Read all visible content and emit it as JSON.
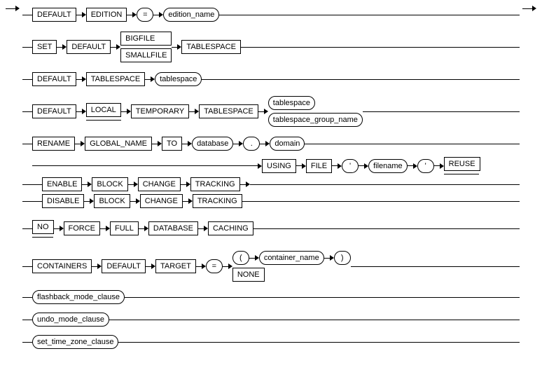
{
  "chart_data": {
    "type": "railroad_diagram",
    "description": "SQL syntax railroad diagram with alternative clauses.",
    "branches": [
      {
        "id": "b1",
        "sequence": [
          "DEFAULT",
          "EDITION",
          {
            "literal": "="
          },
          {
            "nonterminal": "edition_name"
          }
        ]
      },
      {
        "id": "b2",
        "sequence": [
          "SET",
          "DEFAULT",
          {
            "choice": [
              "BIGFILE",
              "SMALLFILE"
            ]
          },
          "TABLESPACE"
        ]
      },
      {
        "id": "b3",
        "sequence": [
          "DEFAULT",
          "TABLESPACE",
          {
            "nonterminal": "tablespace"
          }
        ]
      },
      {
        "id": "b4",
        "sequence": [
          "DEFAULT",
          {
            "optional": "LOCAL"
          },
          "TEMPORARY",
          "TABLESPACE",
          {
            "choice_nt": [
              "tablespace",
              "tablespace_group_name"
            ]
          }
        ]
      },
      {
        "id": "b5",
        "sequence": [
          "RENAME",
          "GLOBAL_NAME",
          "TO",
          {
            "nonterminal": "database"
          },
          {
            "repeat": [
              {
                "literal": "."
              },
              {
                "nonterminal": "domain"
              }
            ]
          }
        ]
      },
      {
        "id": "b6",
        "sequence": [
          "ENABLE",
          "BLOCK",
          "CHANGE",
          "TRACKING",
          {
            "optional_seq": [
              "USING",
              "FILE",
              {
                "literal": "'"
              },
              {
                "nonterminal": "filename"
              },
              {
                "literal": "'"
              },
              {
                "optional": "REUSE"
              }
            ]
          }
        ]
      },
      {
        "id": "b7",
        "sequence": [
          "DISABLE",
          "BLOCK",
          "CHANGE",
          "TRACKING"
        ]
      },
      {
        "id": "b8",
        "sequence": [
          {
            "optional": "NO"
          },
          "FORCE",
          "FULL",
          "DATABASE",
          "CACHING"
        ]
      },
      {
        "id": "b9",
        "sequence": [
          "CONTAINERS",
          "DEFAULT",
          "TARGET",
          {
            "literal": "="
          },
          {
            "choice": [
              {
                "seq": [
                  {
                    "literal": "("
                  },
                  {
                    "nonterminal": "container_name"
                  },
                  {
                    "literal": ")"
                  }
                ]
              },
              "NONE"
            ]
          }
        ]
      },
      {
        "id": "b10",
        "sequence": [
          {
            "nonterminal": "flashback_mode_clause"
          }
        ]
      },
      {
        "id": "b11",
        "sequence": [
          {
            "nonterminal": "undo_mode_clause"
          }
        ]
      },
      {
        "id": "b12",
        "sequence": [
          {
            "nonterminal": "set_time_zone_clause"
          }
        ]
      }
    ]
  },
  "t": {
    "DEFAULT": "DEFAULT",
    "EDITION": "EDITION",
    "eq": "=",
    "edition_name": "edition_name",
    "SET": "SET",
    "BIGFILE": "BIGFILE",
    "SMALLFILE": "SMALLFILE",
    "TABLESPACE": "TABLESPACE",
    "tablespace": "tablespace",
    "LOCAL": "LOCAL",
    "TEMPORARY": "TEMPORARY",
    "tablespace_group_name": "tablespace_group_name",
    "RENAME": "RENAME",
    "GLOBAL_NAME": "GLOBAL_NAME",
    "TO": "TO",
    "database": "database",
    "dot": ".",
    "domain": "domain",
    "ENABLE": "ENABLE",
    "DISABLE": "DISABLE",
    "BLOCK": "BLOCK",
    "CHANGE": "CHANGE",
    "TRACKING": "TRACKING",
    "USING": "USING",
    "FILE": "FILE",
    "quote": "'",
    "filename": "filename",
    "REUSE": "REUSE",
    "NO": "NO",
    "FORCE": "FORCE",
    "FULL": "FULL",
    "DATABASE": "DATABASE",
    "CACHING": "CACHING",
    "CONTAINERS": "CONTAINERS",
    "TARGET": "TARGET",
    "lparen": "(",
    "rparen": ")",
    "container_name": "container_name",
    "NONE": "NONE",
    "flashback_mode_clause": "flashback_mode_clause",
    "undo_mode_clause": "undo_mode_clause",
    "set_time_zone_clause": "set_time_zone_clause"
  }
}
